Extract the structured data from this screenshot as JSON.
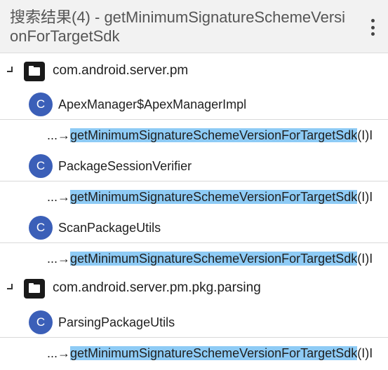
{
  "header": {
    "title": "搜索结果(4) - getMinimumSignatureSchemeVersionForTargetSdk"
  },
  "groups": [
    {
      "package": "com.android.server.pm",
      "classes": [
        {
          "name": "ApexManager$ApexManagerImpl",
          "method": {
            "prefix": "...→",
            "match": "getMinimumSignatureSchemeVersionForTargetSdk",
            "suffix": "(I)I"
          }
        },
        {
          "name": "PackageSessionVerifier",
          "method": {
            "prefix": "...→",
            "match": "getMinimumSignatureSchemeVersionForTargetSdk",
            "suffix": "(I)I"
          }
        },
        {
          "name": "ScanPackageUtils",
          "method": {
            "prefix": "...→",
            "match": "getMinimumSignatureSchemeVersionForTargetSdk",
            "suffix": "(I)I"
          }
        }
      ]
    },
    {
      "package": "com.android.server.pm.pkg.parsing",
      "classes": [
        {
          "name": "ParsingPackageUtils",
          "method": {
            "prefix": "...→",
            "match": "getMinimumSignatureSchemeVersionForTargetSdk",
            "suffix": "(I)I"
          }
        }
      ]
    }
  ],
  "badge_letter": "C",
  "icons": {
    "expand": "collapse-arrow-icon",
    "folder": "folder-icon",
    "menu": "more-vert-icon"
  },
  "colors": {
    "header_bg": "#f2f2f2",
    "class_badge": "#3b5fb8",
    "match_highlight": "#8ecbf5"
  }
}
